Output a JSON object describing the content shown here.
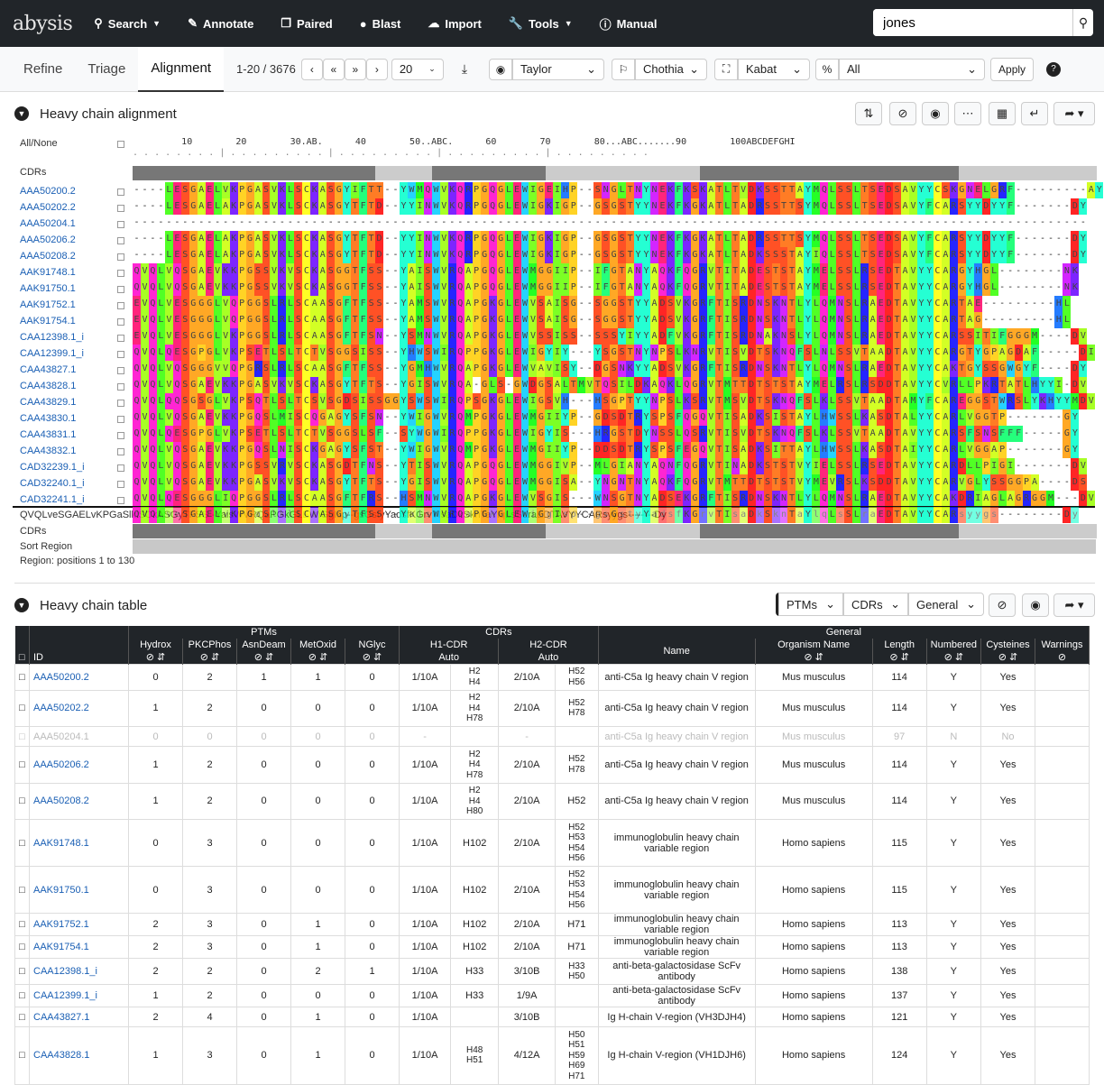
{
  "nav": {
    "logo": "abysis",
    "search": "Search",
    "annotate": "Annotate",
    "paired": "Paired",
    "blast": "Blast",
    "import": "Import",
    "tools": "Tools",
    "manual": "Manual",
    "query": "jones"
  },
  "toolbar": {
    "tabs": [
      "Refine",
      "Triage",
      "Alignment"
    ],
    "range": "1-20 / 3676",
    "page_size": "20",
    "color_scheme": "Taylor",
    "cdr_scheme": "Chothia",
    "numbering": "Kabat",
    "filter": "All",
    "apply": "Apply",
    "help": "?"
  },
  "alignment": {
    "title": "Heavy chain alignment",
    "all_none": "All/None",
    "cdrs": "CDRs",
    "consensus": "QVQLveSGAELvKPGaSlklSCkASGyTFSS--YaisWVRQaPGkGLEWiGgIsp--gsGstyYadsfKGrvTIsaDkSknTaYlqLsSLraEDTAVYYCARsyygs--------Dy",
    "cdrs2": "CDRs",
    "sort_region": "Sort Region",
    "region": "Region: positions 1 to 130",
    "ruler": "         10        20        30.AB.      40        50..ABC.      60        70        80...ABC.......90        100ABCDEFGHI",
    "ids": [
      "AAA50200.2",
      "AAA50202.2",
      "AAA50204.1",
      "AAA50206.2",
      "AAA50208.2",
      "AAK91748.1",
      "AAK91750.1",
      "AAK91752.1",
      "AAK91754.1",
      "CAA12398.1_i",
      "CAA12399.1_i",
      "CAA43827.1",
      "CAA43828.1",
      "CAA43829.1",
      "CAA43830.1",
      "CAA43831.1",
      "CAA43832.1",
      "CAD32239.1_i",
      "CAD32240.1_i",
      "CAD32241.1_i"
    ],
    "seqs": [
      "----LESGAELVKPGASVKLSCKASGYIFTT--YWMQWVKQRPGQGLEWIGEIHP--SNGLTNYNEKFKSKATLTVDKSSTTAYMQLSSLTSEDSAVYYCSKGNELGRF---------AY",
      "----LESGAELAKPGASVKLSCKASGYTFTD--YYINWVKQRPGQGLEWIGKIGP--GSGSTYYNEKFKGKATLTADRSSTTSYMQLSSLTSEDSAVYFCARSYYDYYF-------DY",
      "----------------------------------------------------------------------------------------------------------------------",
      "----LESGAELAKPGASVKLSCKASGYTFTD--YYINWVKQRPGQGLEWIGKIGP--GSGSTYYNEKFKGKATLTADRSSTTSYMQLSSLTSEDSAVYFCARSYYDYYF-------DY",
      "----LESGAELAKPGASVKLSCKASGYTFTD--YYINWVKQRPGQGLEWIGKIGP--GSGSTYYNEKFKGKATLTADKSSSTAYIQLSSLTSEDSAVYFCARSYYDYYF-------DY",
      "QVQLVQSGAEVKKPGSSVKVSCKASGGTFSS--YAISWVRQAPGQGLEWMGGIIP--IFGTANYAQKFQGRVTITADESTSTAYMELSSLRSEDTAVYYCARGYHGL--------NK",
      "QVQLVQSGAEVKKPGSSVKVSCKASGGTFSS--YAISWVRQAPGQGLEWMGGIIP--IFGTANYAQKFQGRVTITADESTSTAYMELSSLRSEDTAVYYCARGYHGL--------NK",
      "EVQLVESGGGLVQPGGSLRLSCAASGFTFSS--YAMSWVRQAPGKGLEWVSAISG--SGGSTYYADSVKGRFTISRDNSKNTLYLQMNSLRAEDTAVYYCARTAE---------HL",
      "EVQLVESGGGLVQPGGSLRLSCAASGFTFSS--YAMSWVRQAPGKGLEWVSAISG--SGGSTYYADSVKGRFTISRDNSKNTLYLQMNSLRAEDTAVYYCARTAG---------HL",
      "EVQLVESGGGLVKPGGSLRLSCAASGFTFSN--YSMNWVRQAPGKGLEWVSSISS--SSSYIYYADFVKGRFTISRDNAKNSLYLQMNSLRAEDTAVYYCARSSITIFGGGM----DV",
      "QVQLQESGPGLVKPSETLSLTCTVSGGSISS--YHWSWIRQPPGKGLEWIGYIY---YSGSTNYNPSLKNRVTISVDTSKNQFSLNLSSVTAADTAVYYCARGTYGPAGDAF-----DI",
      "QVQLVQSGGGVVQPGRSLRLSCAASGFTFSS--YGMHWVRQAPGKGLEWVAVISY--DGSNKYYADSVKGRFTISRDNSKNTLYLQMNSLRAEDTAVYYCAKTGYSSGWGYF----DY",
      "QVQLVQSGAEVKKPGASVKVSCKASGYTFTS--YGISWVRQA-GLS-GWDGSALTMVTQSILDKAQKLQGRVTMTTDTSTSTAYMELRSLRSDDTAVYYCVRLLPKRTATLHYYI-DV",
      "QVQLQQSGSGLVKPSQTLSLTCSVSGDSISSGGYSWSWIRQPSGKGLEWIGSVH---HSGPTYYNPSLKSRVTMSVDTSKNQFSLKLSSVTAADTAMYFCAREGGSTWRSLYKHYYMDV",
      "QVQLVQSGAEVKKPGQSLMISCQGAGYSFSN--YWIGWVRQMPGKGLEWMGIIYP--GDSDTRYSPSFQGQVTISADKSISTAYLHWSSLKASDTALYYCARLVGGTP-------GY",
      "QVQLQESGPGLVKPSETLSLTCTVSGGSLSF--SYWGWIRQPPGKGLEWIGYIS---HRGSTDYNSSLQSRVTISVDTSKNQFSLKLSSVTAADTAVYYCARSFSNSFFF-----GY",
      "QVQLVQSGAEVKKPGQSLNISCKGAGYSFST--YWIGWVRQMPGKGLEWMGIIYP--DDSDTRYSPSFEGQVTISADKSITTAYLHWSSLKASDTAIYYCARLVGGAP-------GY",
      "QVQLVQSGAEVKKPGSSVRVSCKASGDTFNS--YTISWVRQAPGQGLEWMGGIVP--MLGIANYAQNFQGRVTINADKSTSTVYIELSSLRSEDTAVYYCARDLLPIGI-------DV",
      "QVQLVQSGAEVKKPGASVKVSCKASGYTFTS--YGISWVRQAPGQGLEWMGGISA--YNGNTNYAQKFQGRVTMTTDTSTSTVYMEVRSLKSDDTAVYYCARVGLYSSGGPA----DS",
      "QVQLQESGGGLIQPGGSLRLSCAASGFTFRS--HSMNWVRQAPGKGLEWVSGIS---WNSGTNYADSEKGRFTISRDNSKNTLYLQMNSLRAEDTAVYYCAKDRIAGLAGRGGM---DV"
    ]
  },
  "table": {
    "title": "Heavy chain table",
    "menus": [
      "PTMs",
      "CDRs",
      "General"
    ],
    "groups": {
      "ptms": "PTMs",
      "cdrs": "CDRs",
      "general": "General"
    },
    "cols": [
      "Hydrox",
      "PKCPhos",
      "AsnDeam",
      "MetOxid",
      "NGlyc",
      "H1-CDR",
      "H2-CDR",
      "Name",
      "Organism Name",
      "Length",
      "Numbered",
      "Cysteines",
      "Warnings"
    ],
    "id_col": "ID",
    "auto": "Auto",
    "rows": [
      {
        "id": "AAA50200.2",
        "v": [
          "0",
          "2",
          "1",
          "1",
          "0"
        ],
        "h1": "1/10A",
        "h1m": "H2\nH4",
        "h2": "2/10A",
        "h2m": "H52\nH56",
        "name": "anti-C5a Ig heavy chain V region",
        "org": "Mus musculus",
        "len": "114",
        "num": "Y",
        "cys": "Yes"
      },
      {
        "id": "AAA50202.2",
        "v": [
          "1",
          "2",
          "0",
          "0",
          "0"
        ],
        "h1": "1/10A",
        "h1m": "H2\nH4\nH78",
        "h2": "2/10A",
        "h2m": "H52\nH78",
        "name": "anti-C5a Ig heavy chain V region",
        "org": "Mus musculus",
        "len": "114",
        "num": "Y",
        "cys": "Yes"
      },
      {
        "id": "AAA50204.1",
        "v": [
          "0",
          "0",
          "0",
          "0",
          "0"
        ],
        "h1": "-",
        "h1m": "",
        "h2": "-",
        "h2m": "",
        "name": "anti-C5a Ig heavy chain V region",
        "org": "Mus musculus",
        "len": "97",
        "num": "N",
        "cys": "No",
        "dim": true
      },
      {
        "id": "AAA50206.2",
        "v": [
          "1",
          "2",
          "0",
          "0",
          "0"
        ],
        "h1": "1/10A",
        "h1m": "H2\nH4\nH78",
        "h2": "2/10A",
        "h2m": "H52\nH78",
        "name": "anti-C5a Ig heavy chain V region",
        "org": "Mus musculus",
        "len": "114",
        "num": "Y",
        "cys": "Yes"
      },
      {
        "id": "AAA50208.2",
        "v": [
          "1",
          "2",
          "0",
          "0",
          "0"
        ],
        "h1": "1/10A",
        "h1m": "H2\nH4\nH80",
        "h2": "2/10A",
        "h2m": "H52",
        "name": "anti-C5a Ig heavy chain V region",
        "org": "Mus musculus",
        "len": "114",
        "num": "Y",
        "cys": "Yes"
      },
      {
        "id": "AAK91748.1",
        "v": [
          "0",
          "3",
          "0",
          "0",
          "0"
        ],
        "h1": "1/10A",
        "h1m": "H102",
        "h2": "2/10A",
        "h2m": "H52\nH53\nH54\nH56",
        "name": "immunoglobulin heavy chain variable region",
        "org": "Homo sapiens",
        "len": "115",
        "num": "Y",
        "cys": "Yes"
      },
      {
        "id": "AAK91750.1",
        "v": [
          "0",
          "3",
          "0",
          "0",
          "0"
        ],
        "h1": "1/10A",
        "h1m": "H102",
        "h2": "2/10A",
        "h2m": "H52\nH53\nH54\nH56",
        "name": "immunoglobulin heavy chain variable region",
        "org": "Homo sapiens",
        "len": "115",
        "num": "Y",
        "cys": "Yes"
      },
      {
        "id": "AAK91752.1",
        "v": [
          "2",
          "3",
          "0",
          "1",
          "0"
        ],
        "h1": "1/10A",
        "h1m": "H102",
        "h2": "2/10A",
        "h2m": "H71",
        "name": "immunoglobulin heavy chain variable region",
        "org": "Homo sapiens",
        "len": "113",
        "num": "Y",
        "cys": "Yes"
      },
      {
        "id": "AAK91754.1",
        "v": [
          "2",
          "3",
          "0",
          "1",
          "0"
        ],
        "h1": "1/10A",
        "h1m": "H102",
        "h2": "2/10A",
        "h2m": "H71",
        "name": "immunoglobulin heavy chain variable region",
        "org": "Homo sapiens",
        "len": "113",
        "num": "Y",
        "cys": "Yes"
      },
      {
        "id": "CAA12398.1_i",
        "v": [
          "2",
          "2",
          "0",
          "2",
          "1"
        ],
        "h1": "1/10A",
        "h1m": "H33",
        "h2": "3/10B",
        "h2m": "H33\nH50",
        "name": "anti-beta-galactosidase ScFv antibody",
        "org": "Homo sapiens",
        "len": "138",
        "num": "Y",
        "cys": "Yes"
      },
      {
        "id": "CAA12399.1_i",
        "v": [
          "1",
          "2",
          "0",
          "0",
          "0"
        ],
        "h1": "1/10A",
        "h1m": "H33",
        "h2": "1/9A",
        "h2m": "",
        "name": "anti-beta-galactosidase ScFv antibody",
        "org": "Homo sapiens",
        "len": "137",
        "num": "Y",
        "cys": "Yes"
      },
      {
        "id": "CAA43827.1",
        "v": [
          "2",
          "4",
          "0",
          "1",
          "0"
        ],
        "h1": "1/10A",
        "h1m": "",
        "h2": "3/10B",
        "h2m": "",
        "name": "Ig H-chain V-region (VH3DJH4)",
        "org": "Homo sapiens",
        "len": "121",
        "num": "Y",
        "cys": "Yes"
      },
      {
        "id": "CAA43828.1",
        "v": [
          "1",
          "3",
          "0",
          "1",
          "0"
        ],
        "h1": "1/10A",
        "h1m": "H48\nH51",
        "h2": "4/12A",
        "h2m": "H50\nH51\nH59\nH69\nH71",
        "name": "Ig H-chain V-region (VH1DJH6)",
        "org": "Homo sapiens",
        "len": "124",
        "num": "Y",
        "cys": "Yes"
      }
    ]
  }
}
